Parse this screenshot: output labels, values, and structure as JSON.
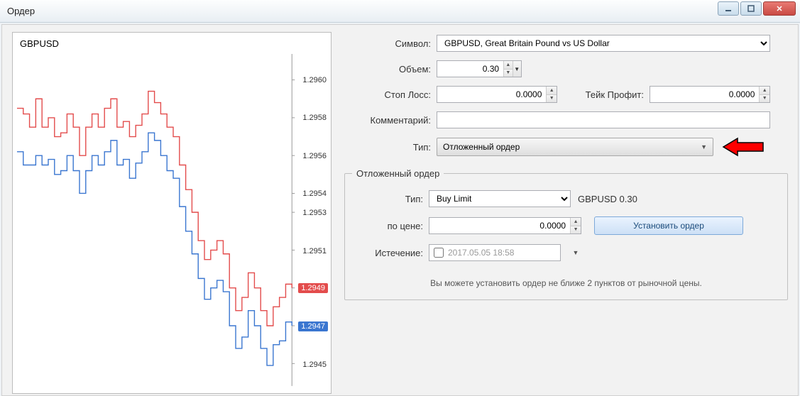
{
  "window": {
    "title": "Ордер"
  },
  "chart": {
    "symbol": "GBPUSD",
    "ask_price": "1.2949",
    "bid_price": "1.2947",
    "y_ticks": [
      "1.2960",
      "1.2958",
      "1.2956",
      "1.2954",
      "1.2953",
      "1.2951",
      "1.2949",
      "1.2947",
      "1.2945"
    ]
  },
  "form": {
    "labels": {
      "symbol": "Символ:",
      "volume": "Объем:",
      "sl": "Стоп Лосс:",
      "tp": "Тейк Профит:",
      "comment": "Комментарий:",
      "type": "Тип:"
    },
    "symbol_value": "GBPUSD, Great Britain Pound vs US Dollar",
    "volume_value": "0.30",
    "sl_value": "0.0000",
    "tp_value": "0.0000",
    "comment_value": "",
    "type_value": "Отложенный ордер"
  },
  "pending": {
    "legend": "Отложенный ордер",
    "labels": {
      "type": "Тип:",
      "price": "по цене:",
      "expiry": "Истечение:"
    },
    "type_value": "Buy Limit",
    "sym_vol": "GBPUSD 0.30",
    "price_value": "0.0000",
    "install_btn": "Установить ордер",
    "expiry_value": "2017.05.05 18:58",
    "note": "Вы можете установить ордер не ближе 2 пунктов от рыночной цены."
  },
  "chart_data": {
    "type": "line",
    "title": "GBPUSD",
    "ylim": [
      1.2944,
      1.2961
    ],
    "series": [
      {
        "name": "ask",
        "color": "#e34c4c",
        "values": [
          1.29585,
          1.29582,
          1.29575,
          1.2959,
          1.29575,
          1.2958,
          1.2957,
          1.29572,
          1.29582,
          1.29575,
          1.2956,
          1.29575,
          1.29582,
          1.29575,
          1.29585,
          1.2959,
          1.29575,
          1.29578,
          1.2957,
          1.29576,
          1.29582,
          1.29594,
          1.29588,
          1.29582,
          1.29575,
          1.2957,
          1.29555,
          1.29542,
          1.2953,
          1.29515,
          1.29505,
          1.2951,
          1.29515,
          1.29508,
          1.2949,
          1.29478,
          1.29485,
          1.29498,
          1.2949,
          1.29478,
          1.2947,
          1.2948,
          1.29485,
          1.29492,
          1.2949
        ]
      },
      {
        "name": "bid",
        "color": "#3a76d0",
        "values": [
          1.29562,
          1.29555,
          1.29555,
          1.2956,
          1.29555,
          1.29558,
          1.2955,
          1.29552,
          1.2956,
          1.29552,
          1.2954,
          1.29552,
          1.2956,
          1.29555,
          1.29562,
          1.29568,
          1.29555,
          1.29558,
          1.29548,
          1.29556,
          1.29562,
          1.29572,
          1.29568,
          1.2956,
          1.29552,
          1.29548,
          1.29533,
          1.2952,
          1.29508,
          1.29495,
          1.29484,
          1.2949,
          1.29494,
          1.29488,
          1.2947,
          1.29458,
          1.29464,
          1.29478,
          1.2947,
          1.29458,
          1.29449,
          1.2946,
          1.29462,
          1.29472,
          1.2947
        ]
      }
    ]
  }
}
